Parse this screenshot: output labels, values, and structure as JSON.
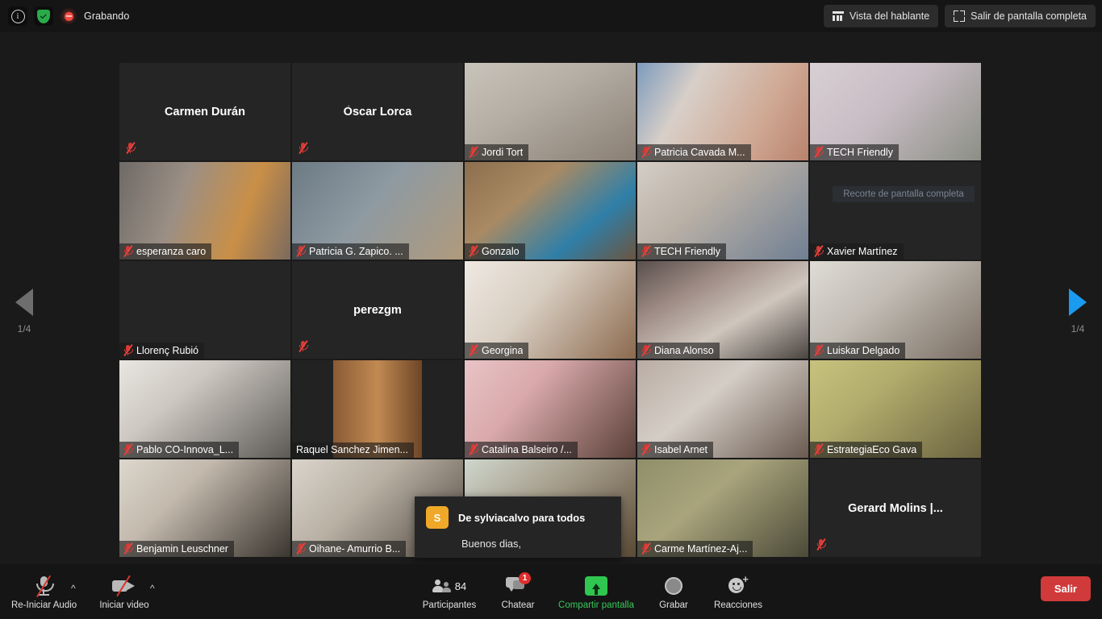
{
  "topbar": {
    "info_icon": "info-circle-icon",
    "security_icon": "shield-check-icon",
    "recording_label": "Grabando",
    "speaker_view_label": "Vista del hablante",
    "exit_fullscreen_label": "Salir de pantalla completa"
  },
  "pager": {
    "left_label": "1/4",
    "right_label": "1/4"
  },
  "ghost_overlay_text": "Recorte de pantalla completa",
  "chat_toast": {
    "avatar_letter": "S",
    "title": "De sylviacalvo para todos",
    "message": "Buenos dias,"
  },
  "toolbar": {
    "audio_label": "Re-Iniciar Audio",
    "video_label": "Iniciar video",
    "participants_label": "Participantes",
    "participants_count": "84",
    "chat_label": "Chatear",
    "chat_badge": "1",
    "share_label": "Compartir pantalla",
    "record_label": "Grabar",
    "reactions_label": "Reacciones",
    "exit_label": "Salir"
  },
  "colors": {
    "accent_green": "#37c95a",
    "exit_red": "#d03a3a",
    "mute_red": "#d43a36",
    "active_speaker": "#d6e84a",
    "pager_active": "#1a9bf0",
    "avatar_orange": "#f0a828"
  },
  "grid": {
    "rows": [
      [
        {
          "name": "Carmen Durán",
          "video": false,
          "muted": true,
          "label_position": "center",
          "bg": "#252525",
          "active": false
        },
        {
          "name": "Òscar Lorca",
          "video": false,
          "muted": true,
          "label_position": "center",
          "bg": "#252525",
          "active": false
        },
        {
          "name": "Jordi Tort",
          "video": true,
          "muted": true,
          "label_position": "bottom",
          "bg": "linear-gradient(150deg,#c9c4bb 0%,#b4aea4 40%,#8a7f74 100%)",
          "active": false
        },
        {
          "name": "Patricia Cavada M...",
          "video": true,
          "muted": true,
          "label_position": "bottom",
          "bg": "linear-gradient(120deg,#7d9bbd 0%,#d8cfc8 30%,#cfa893 70%,#b9836d 100%)",
          "active": false
        },
        {
          "name": "TECH Friendly",
          "video": true,
          "muted": true,
          "label_position": "bottom",
          "bg": "linear-gradient(135deg,#d8cfd4 0%,#c7bcc3 45%,#8c8f86 100%)",
          "active": false
        }
      ],
      [
        {
          "name": "esperanza caro",
          "video": true,
          "muted": true,
          "label_position": "bottom",
          "bg": "linear-gradient(110deg,#6e6a66 0%,#9b8f85 35%,#c98f47 70%,#7b6a5e 100%)",
          "active": false
        },
        {
          "name": "Patricia G. Zapico. ...",
          "video": true,
          "muted": true,
          "label_position": "bottom",
          "bg": "linear-gradient(130deg,#6c7a84 0%,#8e9aa2 45%,#b09a7c 100%)",
          "active": false
        },
        {
          "name": "Gonzalo",
          "video": true,
          "muted": true,
          "label_position": "bottom",
          "bg": "linear-gradient(140deg,#8c6f4e 0%,#a98a63 35%,#2f7fa8 70%,#6b5540 100%)",
          "active": false
        },
        {
          "name": "TECH Friendly",
          "video": true,
          "muted": true,
          "label_position": "bottom",
          "bg": "linear-gradient(140deg,#d5cec6 0%,#b9b0a6 40%,#6f7f93 100%)",
          "active": false
        },
        {
          "name": "Xavier Martínez",
          "video": false,
          "muted": true,
          "label_position": "bottom",
          "bg": "#252525",
          "active": false,
          "ghost": true
        }
      ],
      [
        {
          "name": "Llorenç Rubió",
          "video": false,
          "muted": true,
          "label_position": "bottom",
          "bg": "#252525",
          "active": false
        },
        {
          "name": "perezgm",
          "video": false,
          "muted": true,
          "label_position": "center",
          "bg": "#252525",
          "active": false
        },
        {
          "name": "Georgina",
          "video": true,
          "muted": true,
          "label_position": "bottom",
          "bg": "linear-gradient(130deg,#efe9e2 0%,#d8cec2 40%,#8c6a4e 100%)",
          "active": false
        },
        {
          "name": "Diana Alonso",
          "video": true,
          "muted": true,
          "label_position": "bottom",
          "bg": "linear-gradient(150deg,#5a4f4c 0%,#9d8b84 30%,#cfc6bd 60%,#4a4440 100%)",
          "active": false
        },
        {
          "name": "Luiskar Delgado",
          "video": true,
          "muted": true,
          "label_position": "bottom",
          "bg": "linear-gradient(140deg,#dfdcd6 0%,#c1bcb4 40%,#7a6e63 100%)",
          "active": false
        }
      ],
      [
        {
          "name": "Pablo CO-Innova_L...",
          "video": true,
          "muted": true,
          "label_position": "bottom",
          "bg": "linear-gradient(140deg,#e8e6e1 0%,#cdc8c1 35%,#5d5a56 100%)",
          "active": false
        },
        {
          "name": "Raquel Sanchez Jimen...",
          "video": true,
          "muted": false,
          "label_position": "bottom",
          "bg": "linear-gradient(90deg,#222 0%,#222 24%,#8a5a35 24%,#c08a52 50%,#6e4526 76%,#222 76%,#222 100%)",
          "active": true
        },
        {
          "name": "Catalina Balseiro /...",
          "video": true,
          "muted": true,
          "label_position": "bottom",
          "bg": "linear-gradient(130deg,#e8c4c6 0%,#d9a9ab 35%,#5a4038 100%)",
          "active": false
        },
        {
          "name": "Isabel Arnet",
          "video": true,
          "muted": true,
          "label_position": "bottom",
          "bg": "linear-gradient(140deg,#b9aca3 0%,#d4cdc6 40%,#6a5a50 100%)",
          "active": false
        },
        {
          "name": "EstrategiaEco Gava",
          "video": true,
          "muted": true,
          "label_position": "bottom",
          "bg": "linear-gradient(140deg,#c8c27e 0%,#b3ad6d 35%,#6b6340 100%)",
          "active": false
        }
      ],
      [
        {
          "name": "Benjamin Leuschner",
          "video": true,
          "muted": true,
          "label_position": "bottom",
          "bg": "linear-gradient(135deg,#dcd7cd 0%,#c3b9ad 35%,#3a352f 100%)",
          "active": false
        },
        {
          "name": "Oihane- Amurrio B...",
          "video": true,
          "muted": true,
          "label_position": "bottom",
          "bg": "linear-gradient(135deg,#d9d4cb 0%,#b9b0a4 40%,#50483f 100%)",
          "active": false
        },
        {
          "name": "",
          "video": true,
          "muted": false,
          "label_position": "none",
          "bg": "linear-gradient(140deg,#cfd6cc 0%,#a39a88 45%,#5a4a36 100%)",
          "active": false
        },
        {
          "name": "Carme Martínez-Aj...",
          "video": true,
          "muted": true,
          "label_position": "bottom",
          "bg": "linear-gradient(140deg,#8f8f6a 0%,#a9a47c 40%,#4b4a38 100%)",
          "active": false
        },
        {
          "name": "Gerard Molins |...",
          "video": false,
          "muted": true,
          "label_position": "center",
          "bg": "#252525",
          "active": false
        }
      ]
    ]
  }
}
